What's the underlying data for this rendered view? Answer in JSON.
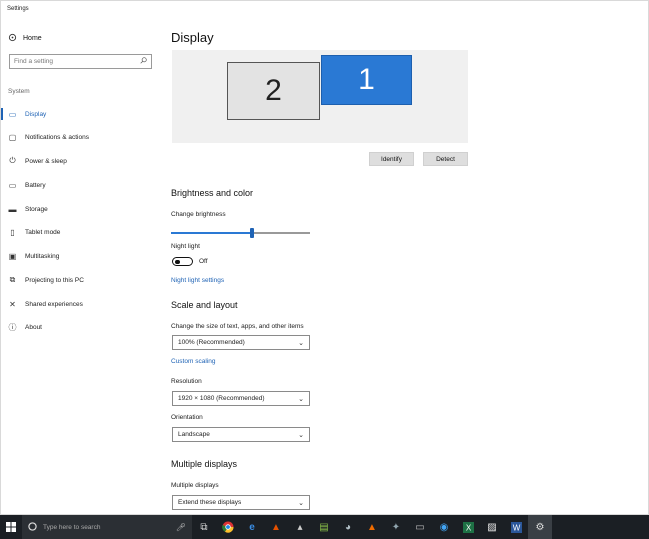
{
  "window": {
    "title": "Settings"
  },
  "sidebar": {
    "home_label": "Home",
    "search_placeholder": "Find a setting",
    "section_label": "System",
    "items": [
      {
        "label": "Display",
        "icon": "monitor-icon",
        "active": true
      },
      {
        "label": "Notifications & actions",
        "icon": "notification-icon"
      },
      {
        "label": "Power & sleep",
        "icon": "power-icon"
      },
      {
        "label": "Battery",
        "icon": "battery-icon"
      },
      {
        "label": "Storage",
        "icon": "storage-icon"
      },
      {
        "label": "Tablet mode",
        "icon": "tablet-icon"
      },
      {
        "label": "Multitasking",
        "icon": "multitasking-icon"
      },
      {
        "label": "Projecting to this PC",
        "icon": "projecting-icon"
      },
      {
        "label": "Shared experiences",
        "icon": "shared-icon"
      },
      {
        "label": "About",
        "icon": "info-icon"
      }
    ]
  },
  "main": {
    "title": "Display",
    "monitors": {
      "secondary": "2",
      "primary": "1"
    },
    "identify_label": "Identify",
    "detect_label": "Detect",
    "brightness": {
      "heading": "Brightness and color",
      "change_label": "Change brightness",
      "value_fraction": 0.58,
      "night_light_label": "Night light",
      "night_light_state": "Off",
      "night_light_settings_link": "Night light settings"
    },
    "scale": {
      "heading": "Scale and layout",
      "size_label": "Change the size of text, apps, and other items",
      "size_value": "100% (Recommended)",
      "custom_scaling_link": "Custom scaling",
      "resolution_label": "Resolution",
      "resolution_value": "1920 × 1080 (Recommended)",
      "orientation_label": "Orientation",
      "orientation_value": "Landscape"
    },
    "multiple": {
      "heading": "Multiple displays",
      "label": "Multiple displays",
      "value": "Extend these displays"
    }
  },
  "taskbar": {
    "search_placeholder": "Type here to search",
    "apps": [
      "task-view-icon",
      "chrome-icon",
      "edge-icon",
      "app-icon",
      "app-icon",
      "photos-icon",
      "app-icon",
      "app-icon",
      "app-icon",
      "app-icon",
      "excel-icon",
      "app-icon",
      "word-icon",
      "settings-icon"
    ]
  },
  "colors": {
    "accent": "#1f63b5",
    "monitor_primary": "#2a79d4",
    "taskbar": "#1b1f24"
  }
}
